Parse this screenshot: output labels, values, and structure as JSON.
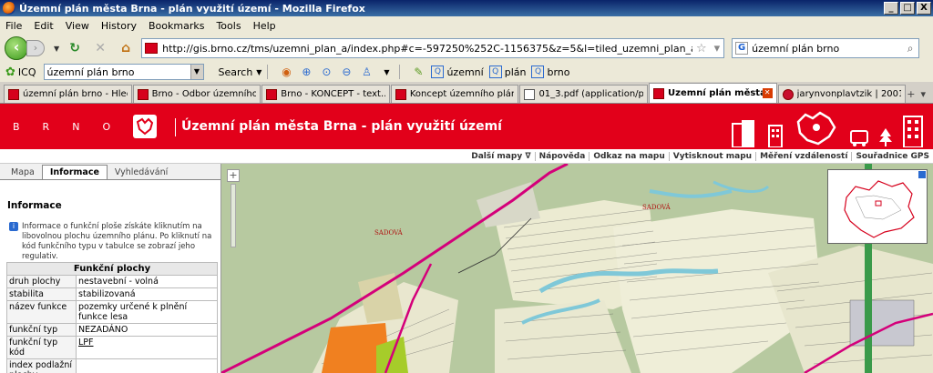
{
  "window": {
    "title": "Územní plán města Brna - plán využití území - Mozilla Firefox",
    "minimize": "_",
    "maximize": "□",
    "close": "X"
  },
  "menu": [
    "File",
    "Edit",
    "View",
    "History",
    "Bookmarks",
    "Tools",
    "Help"
  ],
  "nav": {
    "url": "http://gis.brno.cz/tms/uzemni_plan_a/index.php#c=-597250%252C-1156375&z=5&l=tiled_uzemni_plan_a,parcely_vnk,mc_tiles&p=&",
    "search_value": "územní plán brno"
  },
  "toolbar2": {
    "icq_label": "ICQ",
    "combo_value": "územní plán brno",
    "search_btn": "Search",
    "link1": "územní",
    "link2": "plán",
    "link3": "brno"
  },
  "tabs": [
    {
      "label": "územní plán brno - Hled...",
      "icon": "brno-favicon"
    },
    {
      "label": "Brno - Odbor územního ...",
      "icon": "brno-favicon"
    },
    {
      "label": "Brno - KONCEPT - text...",
      "icon": "brno-favicon"
    },
    {
      "label": "Koncept územního plánu",
      "icon": "brno-favicon"
    },
    {
      "label": "01_3.pdf (application/p...",
      "icon": "pdf-favicon"
    },
    {
      "label": "Územní plán města ...",
      "icon": "brno-favicon",
      "active": true
    },
    {
      "label": "jarynvonplavtzik | 2001...",
      "icon": "apple-favicon"
    }
  ],
  "brno": {
    "letters": [
      "B",
      "R",
      "N",
      "O"
    ],
    "title": "Územní plán města Brna - plán využití území"
  },
  "maptoolbar": [
    "Další mapy ∇",
    "Nápověda",
    "Odkaz na mapu",
    "Vytisknout mapu",
    "Měření vzdáleností",
    "Souřadnice GPS"
  ],
  "leftpanel": {
    "tabs": [
      "Mapa",
      "Informace",
      "Vyhledávání"
    ],
    "active_tab": "Informace",
    "heading": "Informace",
    "info_text": "Informace o funkční ploše získáte kliknutím na libovolnou plochu územního plánu. Po kliknutí na kód funkčního typu v tabulce se zobrazí jeho regulativ.",
    "table_title": "Funkční plochy",
    "rows": [
      {
        "k": "druh plochy",
        "v": "nestavební - volná"
      },
      {
        "k": "stabilita",
        "v": "stabilizovaná"
      },
      {
        "k": "název funkce",
        "v": "pozemky určené k plnění funkce lesa"
      },
      {
        "k": "funkční typ",
        "v": "NEZADÁNO"
      },
      {
        "k": "funkční typ kód",
        "v": "LPF"
      },
      {
        "k": "index podlažní plochy",
        "v": ""
      }
    ]
  },
  "map": {
    "labels": [
      "SADOVÁ",
      "SADOVÁ"
    ],
    "colors": {
      "forest": "#b5c99e",
      "orchard": "#e8e8c8",
      "road": "#d4007a",
      "water": "#7fc8d8",
      "orange": "#f08020"
    }
  }
}
